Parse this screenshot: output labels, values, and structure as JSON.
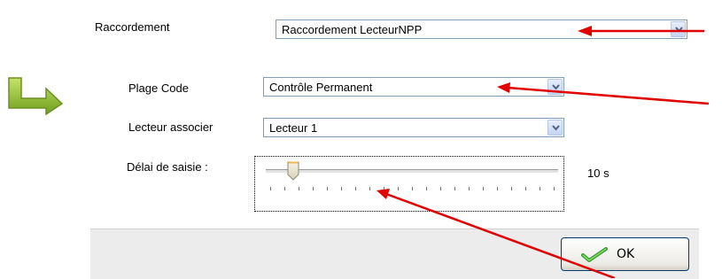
{
  "form": {
    "raccordement": {
      "label": "Raccordement",
      "value": "Raccordement LecteurNPP"
    },
    "plage_code": {
      "label": "Plage Code",
      "value": "Contrôle Permanent"
    },
    "lecteur": {
      "label": "Lecteur associer",
      "value": "Lecteur 1"
    },
    "delai": {
      "label": "Délai de saisie :",
      "value_text": "10 s",
      "level_fraction": 0.0
    }
  },
  "buttons": {
    "ok_label": "OK"
  },
  "colors": {
    "annotation_arrow": "#e00000",
    "corner_arrow": "#8bbf2a",
    "panel": "#ffffff",
    "button_bar": "#ececec"
  },
  "icons": {
    "corner": "green-down-right-arrow-icon",
    "ok": "green-check-icon",
    "drop": "chevron-down-icon"
  }
}
